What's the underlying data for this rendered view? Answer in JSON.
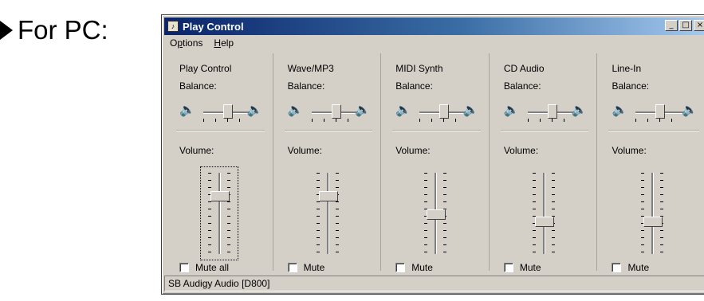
{
  "label": {
    "text": "For PC:"
  },
  "window": {
    "title": "Play Control",
    "controls": [
      "_",
      "□",
      "×"
    ],
    "menu": [
      {
        "label": "Options",
        "mnemonic": "p"
      },
      {
        "label": "Help",
        "mnemonic": "H"
      }
    ],
    "channels": [
      {
        "name": "Play Control",
        "balance_label": "Balance:",
        "volume_label": "Volume:",
        "mute_label": "Mute all",
        "volume": 0.75,
        "balance": 0.0,
        "muted": false,
        "focused": true
      },
      {
        "name": "Wave/MP3",
        "balance_label": "Balance:",
        "volume_label": "Volume:",
        "mute_label": "Mute",
        "volume": 0.75,
        "balance": 0.0,
        "muted": false,
        "focused": false
      },
      {
        "name": "MIDI Synth",
        "balance_label": "Balance:",
        "volume_label": "Volume:",
        "mute_label": "Mute",
        "volume": 0.5,
        "balance": 0.0,
        "muted": false,
        "focused": false
      },
      {
        "name": "CD Audio",
        "balance_label": "Balance:",
        "volume_label": "Volume:",
        "mute_label": "Mute",
        "volume": 0.4,
        "balance": 0.0,
        "muted": false,
        "focused": false
      },
      {
        "name": "Line-In",
        "balance_label": "Balance:",
        "volume_label": "Volume:",
        "mute_label": "Mute",
        "volume": 0.4,
        "balance": 0.0,
        "muted": false,
        "focused": false
      }
    ],
    "status": "SB Audigy Audio [D800]",
    "icons": {
      "speaker_left": "speaker-left-icon",
      "speaker_right": "speaker-right-icon",
      "app": "mixer-app-icon"
    }
  }
}
